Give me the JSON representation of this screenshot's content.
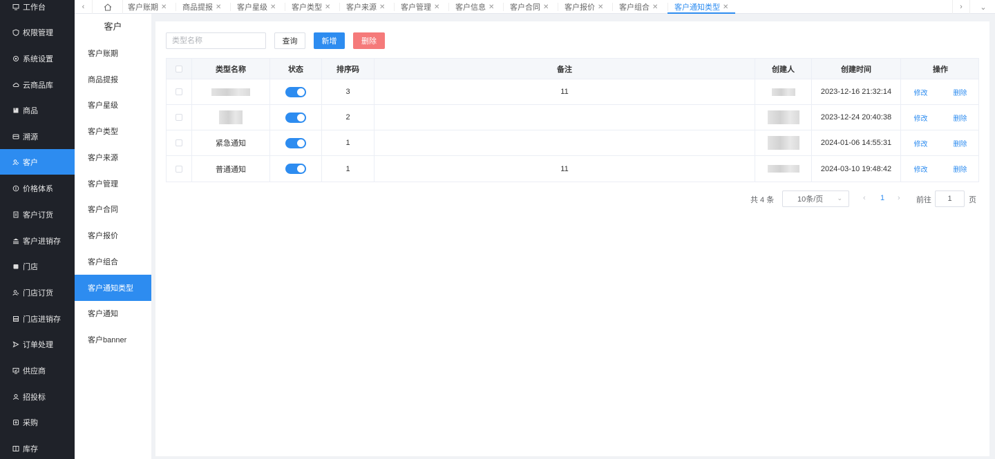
{
  "sidebar": {
    "items": [
      {
        "label": "工作台",
        "icon": "monitor-icon",
        "active": false
      },
      {
        "label": "权限管理",
        "icon": "shield-icon",
        "active": false
      },
      {
        "label": "系统设置",
        "icon": "gear-icon",
        "active": false
      },
      {
        "label": "云商品库",
        "icon": "cloud-icon",
        "active": false
      },
      {
        "label": "商品",
        "icon": "product-icon",
        "active": false
      },
      {
        "label": "溯源",
        "icon": "trace-icon",
        "active": false
      },
      {
        "label": "客户",
        "icon": "customer-icon",
        "active": true
      },
      {
        "label": "价格体系",
        "icon": "price-icon",
        "active": false
      },
      {
        "label": "客户订货",
        "icon": "order-icon",
        "active": false
      },
      {
        "label": "客户进销存",
        "icon": "bank-icon",
        "active": false
      },
      {
        "label": "门店",
        "icon": "store-icon",
        "active": false
      },
      {
        "label": "门店订货",
        "icon": "store-order-icon",
        "active": false
      },
      {
        "label": "门店进销存",
        "icon": "store-stock-icon",
        "active": false
      },
      {
        "label": "订单处理",
        "icon": "send-icon",
        "active": false
      },
      {
        "label": "供应商",
        "icon": "supplier-icon",
        "active": false
      },
      {
        "label": "招投标",
        "icon": "person-icon",
        "active": false
      },
      {
        "label": "采购",
        "icon": "purchase-icon",
        "active": false
      },
      {
        "label": "库存",
        "icon": "inventory-icon",
        "active": false
      }
    ]
  },
  "tabs": [
    {
      "label": "客户账期",
      "closable": true,
      "active": false
    },
    {
      "label": "商品提报",
      "closable": true,
      "active": false
    },
    {
      "label": "客户星级",
      "closable": true,
      "active": false
    },
    {
      "label": "客户类型",
      "closable": true,
      "active": false
    },
    {
      "label": "客户来源",
      "closable": true,
      "active": false
    },
    {
      "label": "客户管理",
      "closable": true,
      "active": false
    },
    {
      "label": "客户信息",
      "closable": true,
      "active": false
    },
    {
      "label": "客户合同",
      "closable": true,
      "active": false
    },
    {
      "label": "客户报价",
      "closable": true,
      "active": false
    },
    {
      "label": "客户组合",
      "closable": true,
      "active": false
    },
    {
      "label": "客户通知类型",
      "closable": true,
      "active": true
    }
  ],
  "tab_close_glyph": "✕",
  "subsidebar": {
    "title": "客户",
    "items": [
      {
        "label": "客户账期",
        "active": false
      },
      {
        "label": "商品提报",
        "active": false
      },
      {
        "label": "客户星级",
        "active": false
      },
      {
        "label": "客户类型",
        "active": false
      },
      {
        "label": "客户来源",
        "active": false
      },
      {
        "label": "客户管理",
        "active": false
      },
      {
        "label": "客户合同",
        "active": false
      },
      {
        "label": "客户报价",
        "active": false
      },
      {
        "label": "客户组合",
        "active": false
      },
      {
        "label": "客户通知类型",
        "active": true
      },
      {
        "label": "客户通知",
        "active": false
      },
      {
        "label": "客户banner",
        "active": false
      }
    ]
  },
  "toolbar": {
    "search_placeholder": "类型名称",
    "query_label": "查询",
    "add_label": "新增",
    "delete_label": "删除"
  },
  "table": {
    "headers": [
      "类型名称",
      "状态",
      "排序码",
      "备注",
      "创建人",
      "创建时间",
      "操作"
    ],
    "rows": [
      {
        "name": "",
        "name_redacted": true,
        "status_on": true,
        "sort": "3",
        "remark": "11",
        "creator_redacted": true,
        "created": "2023-12-16 21:32:14"
      },
      {
        "name": "",
        "name_redacted": true,
        "status_on": true,
        "sort": "2",
        "remark": "",
        "creator_redacted": true,
        "created": "2023-12-24 20:40:38"
      },
      {
        "name": "紧急通知",
        "name_redacted": false,
        "status_on": true,
        "sort": "1",
        "remark": "",
        "creator_redacted": true,
        "created": "2024-01-06 14:55:31"
      },
      {
        "name": "普通通知",
        "name_redacted": false,
        "status_on": true,
        "sort": "1",
        "remark": "11",
        "creator_redacted": true,
        "created": "2024-03-10 19:48:42"
      }
    ],
    "edit_label": "修改",
    "delete_label": "删除"
  },
  "pagination": {
    "total_text": "共 4 条",
    "page_size": "10条/页",
    "current_page": "1",
    "goto_label": "前往",
    "goto_value": "1",
    "goto_unit": "页"
  },
  "colors": {
    "primary": "#2d8cf0",
    "danger": "#f56c6c",
    "sidebar_bg": "#1f2229"
  }
}
